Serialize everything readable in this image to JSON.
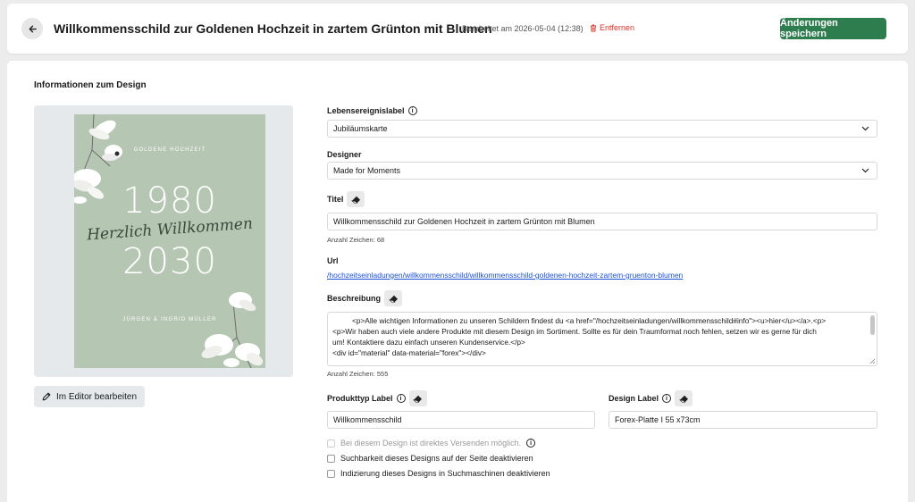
{
  "header": {
    "back_icon": "arrow-left-icon",
    "title": "Willkommensschild zur Goldenen Hochzeit in zartem Grünton mit Blumen",
    "edited": "Bearbeitet am 2026-05-04 (12:38)",
    "remove_label": "Entfernen",
    "save_label": "Änderungen speichern"
  },
  "section": {
    "title": "Informationen zum Design"
  },
  "preview": {
    "header_text": "GOLDENE HOCHZEIT",
    "year_top": "1980",
    "script_text": "Herzlich Willkommen",
    "year_bottom": "2030",
    "names": "JÜRGEN & INGRID MÜLLER",
    "card_color": "#b5c6b2",
    "editor_button": "Im Editor bearbeiten"
  },
  "form": {
    "life_event": {
      "label": "Lebensereignislabel",
      "value": "Jubiläumskarte"
    },
    "designer": {
      "label": "Designer",
      "value": "Made for Moments"
    },
    "title": {
      "label": "Titel",
      "value": "Willkommensschild zur Goldenen Hochzeit in zartem Grünton mit Blumen",
      "char_count": "Anzahl Zeichen: 68"
    },
    "url": {
      "label": "Url",
      "value": "/hochzeitseinladungen/willkommensschild/willkommensschild-goldenen-hochzeit-zartem-gruenton-blumen"
    },
    "description": {
      "label": "Beschreibung",
      "lines": [
        "<p>Alle wichtigen Informationen zu unseren Schildern findest du <a href=\"/hochzeitseinladungen/willkommensschild#info\"><u>hier</u></a>.<p>",
        "<p>Wir haben auch viele andere Produkte mit diesem Design im Sortiment. Sollte es für dein Traumformat noch fehlen, setzen wir es gerne für dich",
        "um! Kontaktiere dazu einfach unseren Kundenservice.</p>",
        "<div id=\"material\" data-material=\"forex\"></div>"
      ],
      "char_count": "Anzahl Zeichen: 555"
    },
    "product_type": {
      "label": "Produkttyp Label",
      "value": "Willkommensschild"
    },
    "design_label": {
      "label": "Design Label",
      "value": "Forex-Platte I 55 x73cm"
    },
    "checkboxes": [
      {
        "label": "Bei diesem Design ist direktes Versenden möglich.",
        "checked": false,
        "disabled": true
      },
      {
        "label": "Suchbarkeit dieses Designs auf der Seite deaktivieren",
        "checked": false,
        "disabled": false
      },
      {
        "label": "Indizierung dieses Designs in Suchmaschinen deaktivieren",
        "checked": false,
        "disabled": false
      }
    ]
  },
  "colors": {
    "accent": "#2e7d4f",
    "danger": "#d93025",
    "link": "#1a4fd6"
  }
}
